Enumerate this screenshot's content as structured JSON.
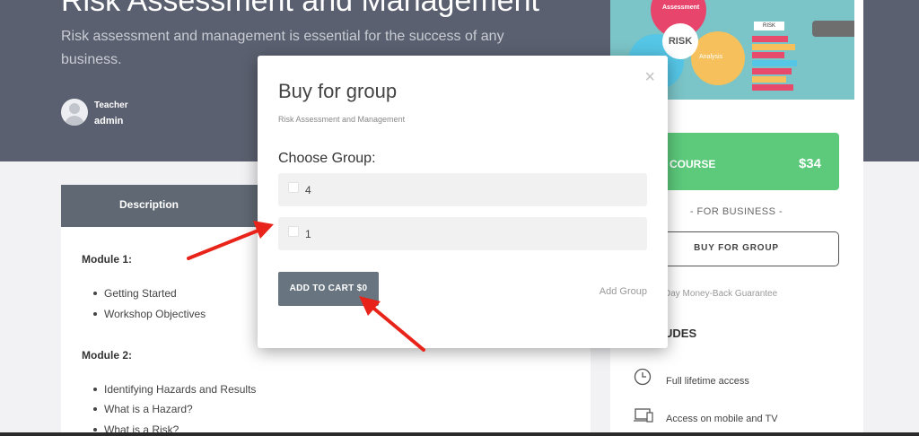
{
  "hero": {
    "title": "Risk Assessment and Management",
    "description": "Risk assessment and management is essential for the success of any business.",
    "teacher_role": "Teacher",
    "teacher_name": "admin"
  },
  "content": {
    "tab_description": "Description",
    "modules": [
      {
        "title": "Module 1:",
        "items": [
          "Getting Started",
          "Workshop Objectives"
        ]
      },
      {
        "title": "Module 2:",
        "items": [
          "Identifying Hazards and Results",
          "What is a Hazard?",
          "What is a Risk?"
        ]
      }
    ]
  },
  "sidebar": {
    "image_labels": {
      "assessment": "Assessment",
      "risk": "RISK",
      "analysis": "Analysis",
      "risk_tag": "RISK"
    },
    "course_label": "COURSE",
    "course_price": "$34",
    "for_business": "- FOR BUSINESS -",
    "buy_for_group": "BUY FOR GROUP",
    "guarantee": "Day Money-Back Guarantee",
    "includes_title": "UDES",
    "includes": [
      {
        "icon": "clock-icon",
        "text": "Full lifetime access"
      },
      {
        "icon": "devices-icon",
        "text": "Access on mobile and TV"
      }
    ]
  },
  "modal": {
    "title": "Buy for group",
    "subtitle": "Risk Assessment and Management",
    "choose_label": "Choose Group:",
    "options": [
      "4",
      "1"
    ],
    "add_to_cart": "ADD TO CART $0",
    "add_group": "Add Group",
    "close": "×"
  },
  "colors": {
    "hero_bg": "#5b6070",
    "course_button": "#5cc97b",
    "cart_button": "#687580",
    "annotation_arrow": "#e8241a"
  }
}
